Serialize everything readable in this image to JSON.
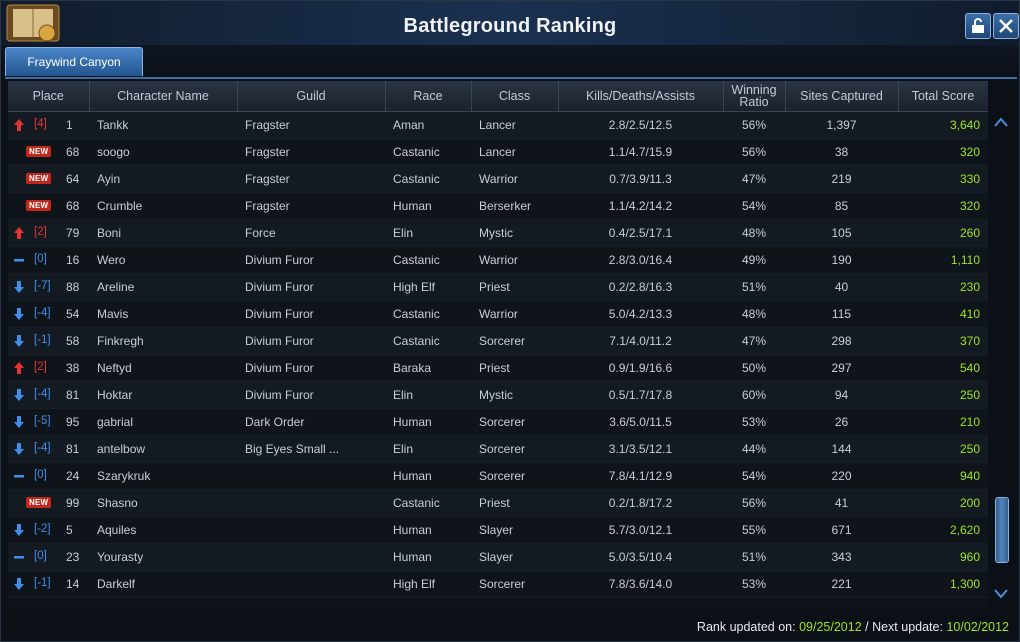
{
  "window": {
    "title": "Battleground Ranking"
  },
  "tabs": [
    {
      "label": "Fraywind Canyon"
    }
  ],
  "table": {
    "headers": {
      "place": "Place",
      "name": "Character Name",
      "guild": "Guild",
      "race": "Race",
      "class": "Class",
      "kda": "Kills/Deaths/Assists",
      "win_line1": "Winning",
      "win_line2": "Ratio",
      "sites": "Sites Captured",
      "score": "Total Score"
    },
    "rows": [
      {
        "trend": "up",
        "delta": "[4]",
        "level": "1",
        "name": "Tankk",
        "guild": "Fragster",
        "race": "Aman",
        "class": "Lancer",
        "kda": "2.8/2.5/12.5",
        "win": "56%",
        "sites": "1,397",
        "score": "3,640"
      },
      {
        "trend": "new",
        "delta": "NEW",
        "level": "68",
        "name": "soogo",
        "guild": "Fragster",
        "race": "Castanic",
        "class": "Lancer",
        "kda": "1.1/4.7/15.9",
        "win": "56%",
        "sites": "38",
        "score": "320"
      },
      {
        "trend": "new",
        "delta": "NEW",
        "level": "64",
        "name": "Ayin",
        "guild": "Fragster",
        "race": "Castanic",
        "class": "Warrior",
        "kda": "0.7/3.9/11.3",
        "win": "47%",
        "sites": "219",
        "score": "330"
      },
      {
        "trend": "new",
        "delta": "NEW",
        "level": "68",
        "name": "Crumble",
        "guild": "Fragster",
        "race": "Human",
        "class": "Berserker",
        "kda": "1.1/4.2/14.2",
        "win": "54%",
        "sites": "85",
        "score": "320"
      },
      {
        "trend": "up",
        "delta": "[2]",
        "level": "79",
        "name": "Boni",
        "guild": "Force",
        "race": "Elin",
        "class": "Mystic",
        "kda": "0.4/2.5/17.1",
        "win": "48%",
        "sites": "105",
        "score": "260"
      },
      {
        "trend": "same",
        "delta": "[0]",
        "level": "16",
        "name": "Wero",
        "guild": "Divium Furor",
        "race": "Castanic",
        "class": "Warrior",
        "kda": "2.8/3.0/16.4",
        "win": "49%",
        "sites": "190",
        "score": "1,110"
      },
      {
        "trend": "down",
        "delta": "[-7]",
        "level": "88",
        "name": "Areline",
        "guild": "Divium Furor",
        "race": "High Elf",
        "class": "Priest",
        "kda": "0.2/2.8/16.3",
        "win": "51%",
        "sites": "40",
        "score": "230"
      },
      {
        "trend": "down",
        "delta": "[-4]",
        "level": "54",
        "name": "Mavis",
        "guild": "Divium Furor",
        "race": "Castanic",
        "class": "Warrior",
        "kda": "5.0/4.2/13.3",
        "win": "48%",
        "sites": "115",
        "score": "410"
      },
      {
        "trend": "down",
        "delta": "[-1]",
        "level": "58",
        "name": "Finkregh",
        "guild": "Divium Furor",
        "race": "Castanic",
        "class": "Sorcerer",
        "kda": "7.1/4.0/11.2",
        "win": "47%",
        "sites": "298",
        "score": "370"
      },
      {
        "trend": "up",
        "delta": "[2]",
        "level": "38",
        "name": "Neftyd",
        "guild": "Divium Furor",
        "race": "Baraka",
        "class": "Priest",
        "kda": "0.9/1.9/16.6",
        "win": "50%",
        "sites": "297",
        "score": "540"
      },
      {
        "trend": "down",
        "delta": "[-4]",
        "level": "81",
        "name": "Hoktar",
        "guild": "Divium Furor",
        "race": "Elin",
        "class": "Mystic",
        "kda": "0.5/1.7/17.8",
        "win": "60%",
        "sites": "94",
        "score": "250"
      },
      {
        "trend": "down",
        "delta": "[-5]",
        "level": "95",
        "name": "gabrial",
        "guild": "Dark Order",
        "race": "Human",
        "class": "Sorcerer",
        "kda": "3.6/5.0/11.5",
        "win": "53%",
        "sites": "26",
        "score": "210"
      },
      {
        "trend": "down",
        "delta": "[-4]",
        "level": "81",
        "name": "antelbow",
        "guild": "Big Eyes Small ...",
        "race": "Elin",
        "class": "Sorcerer",
        "kda": "3.1/3.5/12.1",
        "win": "44%",
        "sites": "144",
        "score": "250"
      },
      {
        "trend": "same",
        "delta": "[0]",
        "level": "24",
        "name": "Szarykruk",
        "guild": "",
        "race": "Human",
        "class": "Sorcerer",
        "kda": "7.8/4.1/12.9",
        "win": "54%",
        "sites": "220",
        "score": "940"
      },
      {
        "trend": "new",
        "delta": "NEW",
        "level": "99",
        "name": "Shasno",
        "guild": "",
        "race": "Castanic",
        "class": "Priest",
        "kda": "0.2/1.8/17.2",
        "win": "56%",
        "sites": "41",
        "score": "200"
      },
      {
        "trend": "down",
        "delta": "[-2]",
        "level": "5",
        "name": "Aquiles",
        "guild": "",
        "race": "Human",
        "class": "Slayer",
        "kda": "5.7/3.0/12.1",
        "win": "55%",
        "sites": "671",
        "score": "2,620"
      },
      {
        "trend": "same",
        "delta": "[0]",
        "level": "23",
        "name": "Yourasty",
        "guild": "",
        "race": "Human",
        "class": "Slayer",
        "kda": "5.0/3.5/10.4",
        "win": "51%",
        "sites": "343",
        "score": "960"
      },
      {
        "trend": "down",
        "delta": "[-1]",
        "level": "14",
        "name": "Darkelf",
        "guild": "",
        "race": "High Elf",
        "class": "Sorcerer",
        "kda": "7.8/3.6/14.0",
        "win": "53%",
        "sites": "221",
        "score": "1,300"
      }
    ]
  },
  "footer": {
    "rank_label": "Rank updated on: ",
    "rank_date": "09/25/2012",
    "next_label": " / Next update: ",
    "next_date": "10/02/2012"
  },
  "colors": {
    "up": "#e23434",
    "down": "#3f8ee8",
    "score": "#9fe31f",
    "new_badge": "#c0281c"
  },
  "icons": {
    "up": "arrow-up-icon",
    "down": "arrow-down-icon",
    "same": "dash-icon"
  }
}
